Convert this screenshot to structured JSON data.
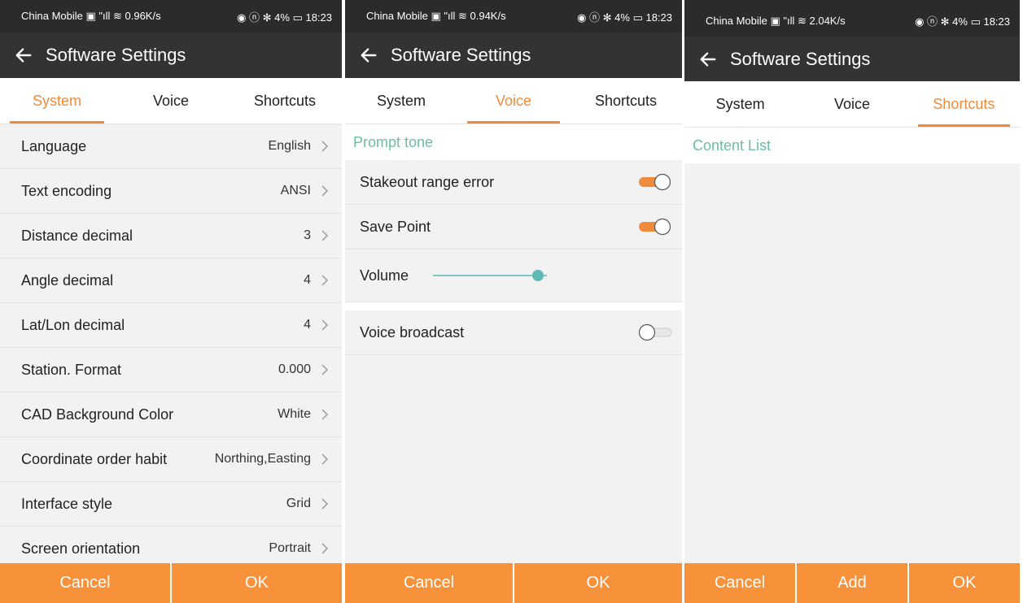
{
  "accent": "#f08a3c",
  "section_color": "#6bbf9f",
  "panel_system": {
    "status": {
      "left": "China Mobile ▣ \"ıll ≋ 0.96K/s",
      "right": "◉ ⓝ ✻ 4% ▭ 18:23"
    },
    "title": "Software Settings",
    "tabs": [
      "System",
      "Voice",
      "Shortcuts"
    ],
    "active_tab": "System",
    "rows": [
      {
        "label": "Language",
        "value": "English"
      },
      {
        "label": "Text encoding",
        "value": "ANSI"
      },
      {
        "label": "Distance decimal",
        "value": "3"
      },
      {
        "label": "Angle decimal",
        "value": "4"
      },
      {
        "label": "Lat/Lon decimal",
        "value": "4"
      },
      {
        "label": "Station. Format",
        "value": "0.000"
      },
      {
        "label": "CAD Background Color",
        "value": "White"
      },
      {
        "label": "Coordinate order habit",
        "value": "Northing,Easting"
      },
      {
        "label": "Interface style",
        "value": "Grid"
      },
      {
        "label": "Screen orientation",
        "value": "Portrait"
      }
    ],
    "buttons": [
      "Cancel",
      "OK"
    ]
  },
  "panel_voice": {
    "status": {
      "left": "China Mobile ▣ \"ıll ≋ 0.94K/s",
      "right": "◉ ⓝ ✻ 4% ▭ 18:23"
    },
    "title": "Software Settings",
    "tabs": [
      "System",
      "Voice",
      "Shortcuts"
    ],
    "active_tab": "Voice",
    "section": "Prompt tone",
    "stakeout_label": "Stakeout range error",
    "stakeout_on": true,
    "save_point_label": "Save Point",
    "save_point_on": true,
    "volume_label": "Volume",
    "volume_level": 0.92,
    "broadcast_label": "Voice broadcast",
    "broadcast_on": false,
    "buttons": [
      "Cancel",
      "OK"
    ]
  },
  "panel_shortcuts": {
    "status": {
      "left": "China Mobile ▣ \"ıll ≋ 2.04K/s",
      "right": "◉ ⓝ ✻ 4% ▭ 18:23"
    },
    "title": "Software Settings",
    "tabs": [
      "System",
      "Voice",
      "Shortcuts"
    ],
    "active_tab": "Shortcuts",
    "section": "Content List",
    "buttons": [
      "Cancel",
      "Add",
      "OK"
    ]
  }
}
